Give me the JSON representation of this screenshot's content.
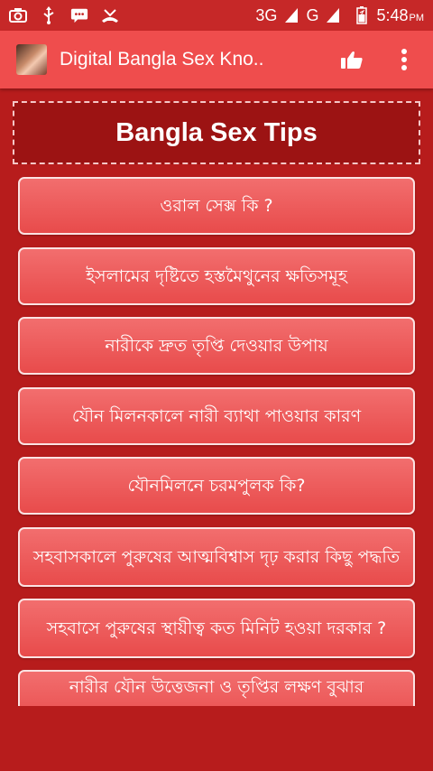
{
  "status_bar": {
    "icons_left": [
      "camera-icon",
      "usb-icon",
      "messenger-icon",
      "missed-call-icon"
    ],
    "network_1": "3G",
    "network_2": "G",
    "time": "5:48",
    "ampm": "PM"
  },
  "app_bar": {
    "title": "Digital Bangla Sex Kno..",
    "actions": [
      "thumbs-up-icon",
      "overflow-menu-icon"
    ]
  },
  "header": {
    "title": "Bangla Sex Tips"
  },
  "menu_items": [
    {
      "label": "ওরাল সেক্স কি ?"
    },
    {
      "label": "ইসলামের দৃষ্টিতে হস্তমৈথুনের ক্ষতিসমূহ"
    },
    {
      "label": "নারীকে দ্রুত তৃপ্তি দেওয়ার উপায়"
    },
    {
      "label": "যৌন মিলনকালে নারী ব্যাথা পাওয়ার কারণ"
    },
    {
      "label": "যৌনমিলনে চরমপুলক কি?"
    },
    {
      "label": "সহবাসকালে পুরুষের আত্মবিশ্বাস দৃঢ় করার কিছু পদ্ধতি"
    },
    {
      "label": "সহবাসে পুরুষের স্থায়ীত্ব কত মিনিট হওয়া দরকার ?"
    },
    {
      "label": "নারীর যৌন উত্তেজনা ও তৃপ্তির লক্ষণ বুঝার"
    }
  ],
  "colors": {
    "status_bar": "#c62828",
    "app_bar": "#ef4d4d",
    "background": "#b71c1c",
    "button": "#ee5a5a"
  }
}
